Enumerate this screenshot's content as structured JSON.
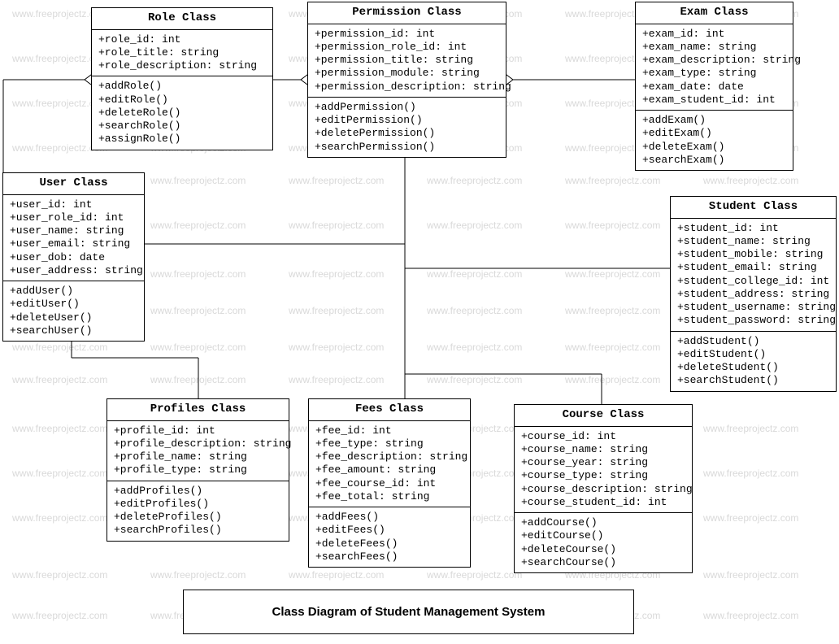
{
  "title": "Class Diagram of Student Management System",
  "watermark": "www.freeprojectz.com",
  "classes": {
    "role": {
      "name": "Role Class",
      "attrs": [
        "+role_id: int",
        "+role_title: string",
        "+role_description: string"
      ],
      "methods": [
        "+addRole()",
        "+editRole()",
        "+deleteRole()",
        "+searchRole()",
        "+assignRole()"
      ]
    },
    "permission": {
      "name": "Permission Class",
      "attrs": [
        "+permission_id: int",
        "+permission_role_id: int",
        "+permission_title: string",
        "+permission_module: string",
        "+permission_description: string"
      ],
      "methods": [
        "+addPermission()",
        "+editPermission()",
        "+deletePermission()",
        "+searchPermission()"
      ]
    },
    "exam": {
      "name": "Exam Class",
      "attrs": [
        "+exam_id: int",
        "+exam_name: string",
        "+exam_description: string",
        "+exam_type: string",
        "+exam_date: date",
        "+exam_student_id: int"
      ],
      "methods": [
        "+addExam()",
        "+editExam()",
        "+deleteExam()",
        "+searchExam()"
      ]
    },
    "user": {
      "name": "User Class",
      "attrs": [
        "+user_id: int",
        "+user_role_id: int",
        "+user_name: string",
        "+user_email: string",
        "+user_dob: date",
        "+user_address: string"
      ],
      "methods": [
        "+addUser()",
        "+editUser()",
        "+deleteUser()",
        "+searchUser()"
      ]
    },
    "student": {
      "name": "Student Class",
      "attrs": [
        "+student_id: int",
        "+student_name: string",
        "+student_mobile: string",
        "+student_email: string",
        "+student_college_id: int",
        "+student_address: string",
        "+student_username: string",
        "+student_password: string"
      ],
      "methods": [
        "+addStudent()",
        "+editStudent()",
        "+deleteStudent()",
        "+searchStudent()"
      ]
    },
    "profiles": {
      "name": "Profiles Class",
      "attrs": [
        "+profile_id: int",
        "+profile_description: string",
        "+profile_name: string",
        "+profile_type: string"
      ],
      "methods": [
        "+addProfiles()",
        "+editProfiles()",
        "+deleteProfiles()",
        "+searchProfiles()"
      ]
    },
    "fees": {
      "name": "Fees Class",
      "attrs": [
        "+fee_id: int",
        "+fee_type: string",
        "+fee_description: string",
        "+fee_amount: string",
        "+fee_course_id: int",
        "+fee_total: string"
      ],
      "methods": [
        "+addFees()",
        "+editFees()",
        "+deleteFees()",
        "+searchFees()"
      ]
    },
    "course": {
      "name": "Course Class",
      "attrs": [
        "+course_id: int",
        "+course_name: string",
        "+course_year: string",
        "+course_type: string",
        "+course_description: string",
        "+course_student_id: int"
      ],
      "methods": [
        "+addCourse()",
        "+editCourse()",
        "+deleteCourse()",
        "+searchCourse()"
      ]
    }
  }
}
